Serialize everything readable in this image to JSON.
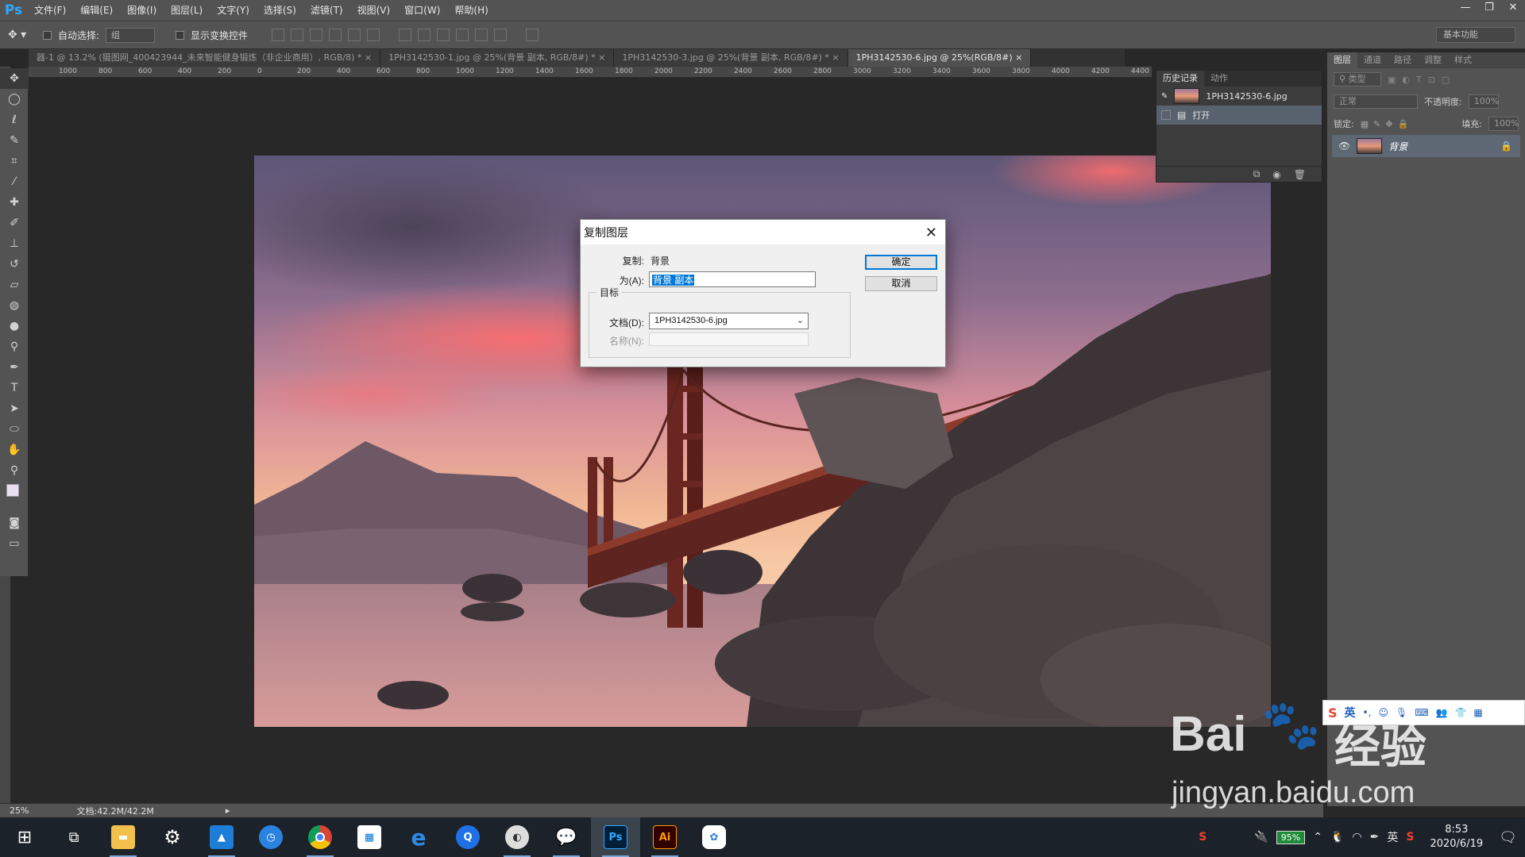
{
  "app": {
    "logo": "Ps",
    "menu": [
      "文件(F)",
      "编辑(E)",
      "图像(I)",
      "图层(L)",
      "文字(Y)",
      "选择(S)",
      "滤镜(T)",
      "视图(V)",
      "窗口(W)",
      "帮助(H)"
    ],
    "window_controls": [
      "—",
      "❐",
      "✕"
    ]
  },
  "options_bar": {
    "auto_select_label": "自动选择:",
    "auto_select_value": "组",
    "transform_label": "显示变换控件",
    "workspace": "基本功能"
  },
  "doc_tabs": [
    {
      "label": "器-1 @ 13.2% (摄图网_400423944_未来智能健身锻炼（非企业商用）, RGB/8) *",
      "active": false
    },
    {
      "label": "1PH3142530-1.jpg @ 25%(背景 副本, RGB/8#) *",
      "active": false
    },
    {
      "label": "1PH3142530-3.jpg @ 25%(背景 副本, RGB/8#) *",
      "active": false
    },
    {
      "label": "1PH3142530-6.jpg @ 25%(RGB/8#)",
      "active": true
    }
  ],
  "ruler": [
    "1000",
    "800",
    "600",
    "400",
    "200",
    "0",
    "200",
    "400",
    "600",
    "800",
    "1000",
    "1200",
    "1400",
    "1600",
    "1800",
    "2000",
    "2200",
    "2400",
    "2600",
    "2800",
    "3000",
    "3200",
    "3400",
    "3600",
    "3800",
    "4000",
    "4200",
    "4400"
  ],
  "history_panel": {
    "tabs": [
      "历史记录",
      "动作"
    ],
    "snapshot": "1PH3142530-6.jpg",
    "steps": [
      "打开"
    ]
  },
  "layers_panel": {
    "tabs": [
      "图层",
      "通道",
      "路径",
      "调整",
      "样式"
    ],
    "filter_label": "类型",
    "blend_mode": "正常",
    "opacity_label": "不透明度:",
    "opacity_value": "100%",
    "lock_label": "锁定:",
    "fill_label": "填充:",
    "fill_value": "100%",
    "layers": [
      {
        "name": "背景",
        "visible": true,
        "locked": true
      }
    ]
  },
  "dialog": {
    "title": "复制图层",
    "copy_label": "复制:",
    "copy_value": "背景",
    "as_label": "为(A):",
    "as_value": "背景 副本",
    "group_label": "目标",
    "doc_label": "文档(D):",
    "doc_value": "1PH3142530-6.jpg",
    "name_label": "名称(N):",
    "ok_button": "确定",
    "cancel_button": "取消"
  },
  "status": {
    "zoom": "25%",
    "doc_size": "文档:42.2M/42.2M"
  },
  "taskbar": {
    "apps": [
      "start",
      "task-view",
      "file-explorer",
      "settings",
      "photos",
      "clock-app",
      "chrome",
      "store",
      "internet-explorer",
      "qq-browser",
      "media-app",
      "wechat",
      "photoshop",
      "illustrator",
      "baidu-netdisk"
    ],
    "battery": "95%",
    "ime": "英",
    "time": "8:53",
    "date": "2020/6/19"
  },
  "watermark": {
    "brand": "Bai",
    "brand2": "经验",
    "url": "jingyan.baidu.com"
  },
  "ime_bar": {
    "lang": "英"
  },
  "colors": {
    "panel": "#535353",
    "canvas_bg": "#282828",
    "accent": "#31a8ff",
    "selection": "#0078d7"
  }
}
